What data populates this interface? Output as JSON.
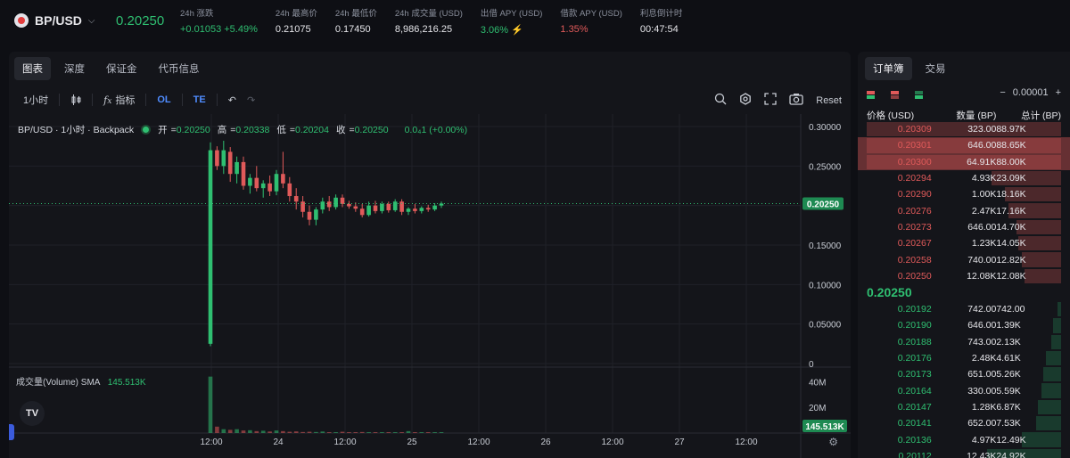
{
  "header": {
    "pair": "BP/USD",
    "last_price": "0.20250",
    "stats": [
      {
        "label": "24h 涨跌",
        "value": "+0.01053 +5.49%",
        "tone": "green"
      },
      {
        "label": "24h 最高价",
        "value": "0.21075",
        "tone": ""
      },
      {
        "label": "24h 最低价",
        "value": "0.17450",
        "tone": ""
      },
      {
        "label": "24h 成交量 (USD)",
        "value": "8,986,216.25",
        "tone": ""
      },
      {
        "label": "出借 APY (USD)",
        "value": "3.06% ⚡",
        "tone": "green"
      },
      {
        "label": "借款 APY (USD)",
        "value": "1.35%",
        "tone": "red"
      },
      {
        "label": "利息倒计时",
        "value": "00:47:54",
        "tone": ""
      }
    ]
  },
  "chart_tabs": [
    {
      "label": "图表",
      "active": true
    },
    {
      "label": "深度",
      "active": false
    },
    {
      "label": "保证金",
      "active": false
    },
    {
      "label": "代币信息",
      "active": false
    }
  ],
  "toolbar": {
    "interval": "1小时",
    "indicators": "指标",
    "ol": "OL",
    "te": "TE",
    "reset": "Reset"
  },
  "legend": {
    "title": "BP/USD · 1小时 · Backpack",
    "ohlc": [
      {
        "k": "开",
        "v": "0.20250"
      },
      {
        "k": "高",
        "v": "0.20338"
      },
      {
        "k": "低",
        "v": "0.20204"
      },
      {
        "k": "收",
        "v": "0.20250"
      }
    ],
    "change": "0.0₄1 (+0.00%)"
  },
  "volume_legend": {
    "label": "成交量(Volume) SMA",
    "value": "145.513K"
  },
  "tv_logo": "TV",
  "chart_data": {
    "type": "candlestick",
    "x_ticks": [
      "12:00",
      "24",
      "12:00",
      "25",
      "12:00",
      "26",
      "12:00",
      "27",
      "12:00"
    ],
    "price_axis": [
      "0.30000",
      "0.25000",
      "0.20000",
      "0.15000",
      "0.10000",
      "0.05000",
      "0"
    ],
    "ylim": [
      0,
      0.3
    ],
    "current_price": "0.20250",
    "volume_axis": [
      "40M",
      "20M"
    ],
    "volume_current": "145.513K",
    "colors": {
      "up": "#2fbf71",
      "down": "#e05a5a"
    },
    "candles": [
      {
        "o": 0.025,
        "h": 0.28,
        "l": 0.022,
        "c": 0.27
      },
      {
        "o": 0.27,
        "h": 0.275,
        "l": 0.245,
        "c": 0.25
      },
      {
        "o": 0.25,
        "h": 0.282,
        "l": 0.24,
        "c": 0.27
      },
      {
        "o": 0.268,
        "h": 0.274,
        "l": 0.23,
        "c": 0.24
      },
      {
        "o": 0.24,
        "h": 0.262,
        "l": 0.228,
        "c": 0.255
      },
      {
        "o": 0.255,
        "h": 0.262,
        "l": 0.22,
        "c": 0.225
      },
      {
        "o": 0.225,
        "h": 0.24,
        "l": 0.215,
        "c": 0.235
      },
      {
        "o": 0.235,
        "h": 0.25,
        "l": 0.218,
        "c": 0.222
      },
      {
        "o": 0.222,
        "h": 0.232,
        "l": 0.21,
        "c": 0.228
      },
      {
        "o": 0.228,
        "h": 0.238,
        "l": 0.212,
        "c": 0.218
      },
      {
        "o": 0.218,
        "h": 0.245,
        "l": 0.213,
        "c": 0.24
      },
      {
        "o": 0.24,
        "h": 0.268,
        "l": 0.222,
        "c": 0.228
      },
      {
        "o": 0.228,
        "h": 0.236,
        "l": 0.205,
        "c": 0.212
      },
      {
        "o": 0.212,
        "h": 0.222,
        "l": 0.195,
        "c": 0.205
      },
      {
        "o": 0.205,
        "h": 0.212,
        "l": 0.185,
        "c": 0.192
      },
      {
        "o": 0.192,
        "h": 0.2,
        "l": 0.175,
        "c": 0.182
      },
      {
        "o": 0.182,
        "h": 0.198,
        "l": 0.175,
        "c": 0.195
      },
      {
        "o": 0.195,
        "h": 0.21,
        "l": 0.19,
        "c": 0.205
      },
      {
        "o": 0.205,
        "h": 0.212,
        "l": 0.193,
        "c": 0.198
      },
      {
        "o": 0.198,
        "h": 0.214,
        "l": 0.195,
        "c": 0.21
      },
      {
        "o": 0.21,
        "h": 0.214,
        "l": 0.198,
        "c": 0.202
      },
      {
        "o": 0.202,
        "h": 0.206,
        "l": 0.196,
        "c": 0.199
      },
      {
        "o": 0.199,
        "h": 0.204,
        "l": 0.192,
        "c": 0.196
      },
      {
        "o": 0.196,
        "h": 0.202,
        "l": 0.185,
        "c": 0.188
      },
      {
        "o": 0.188,
        "h": 0.205,
        "l": 0.186,
        "c": 0.2
      },
      {
        "o": 0.2,
        "h": 0.206,
        "l": 0.19,
        "c": 0.193
      },
      {
        "o": 0.193,
        "h": 0.205,
        "l": 0.19,
        "c": 0.202
      },
      {
        "o": 0.202,
        "h": 0.205,
        "l": 0.191,
        "c": 0.194
      },
      {
        "o": 0.194,
        "h": 0.208,
        "l": 0.192,
        "c": 0.205
      },
      {
        "o": 0.205,
        "h": 0.208,
        "l": 0.188,
        "c": 0.192
      },
      {
        "o": 0.192,
        "h": 0.198,
        "l": 0.188,
        "c": 0.196
      },
      {
        "o": 0.196,
        "h": 0.202,
        "l": 0.19,
        "c": 0.193
      },
      {
        "o": 0.193,
        "h": 0.199,
        "l": 0.19,
        "c": 0.197
      },
      {
        "o": 0.197,
        "h": 0.201,
        "l": 0.192,
        "c": 0.195
      },
      {
        "o": 0.195,
        "h": 0.203,
        "l": 0.193,
        "c": 0.2
      },
      {
        "o": 0.2,
        "h": 0.205,
        "l": 0.197,
        "c": 0.2025
      }
    ],
    "volumes": [
      44,
      5,
      3,
      2.5,
      3,
      2,
      2.2,
      1.5,
      1.8,
      1.2,
      2,
      1.5,
      1,
      1.3,
      0.8,
      1,
      0.8,
      1.2,
      0.7,
      0.6,
      1,
      0.5,
      0.6,
      0.8,
      0.5,
      0.5,
      0.4,
      0.4,
      0.3,
      0.6,
      1.5,
      0.3,
      0.3,
      0.2,
      0.2,
      0.15
    ]
  },
  "orderbook": {
    "tabs": [
      {
        "label": "订单簿",
        "active": true
      },
      {
        "label": "交易",
        "active": false
      }
    ],
    "tick_size": "0.00001",
    "headers": [
      "价格 (USD)",
      "数量 (BP)",
      "总计 (BP)"
    ],
    "asks": [
      {
        "price": "0.20309",
        "qty": "323.00",
        "total": "88.97K",
        "depth": 1.0,
        "hl": false
      },
      {
        "price": "0.20301",
        "qty": "646.00",
        "total": "88.65K",
        "depth": 1.0,
        "hl": true
      },
      {
        "price": "0.20300",
        "qty": "64.91K",
        "total": "88.00K",
        "depth": 1.0,
        "hl": true
      },
      {
        "price": "0.20294",
        "qty": "4.93K",
        "total": "23.09K",
        "depth": 0.36
      },
      {
        "price": "0.20290",
        "qty": "1.00K",
        "total": "18.16K",
        "depth": 0.29
      },
      {
        "price": "0.20276",
        "qty": "2.47K",
        "total": "17.16K",
        "depth": 0.27
      },
      {
        "price": "0.20273",
        "qty": "646.00",
        "total": "14.70K",
        "depth": 0.23
      },
      {
        "price": "0.20267",
        "qty": "1.23K",
        "total": "14.05K",
        "depth": 0.22
      },
      {
        "price": "0.20258",
        "qty": "740.00",
        "total": "12.82K",
        "depth": 0.2
      },
      {
        "price": "0.20250",
        "qty": "12.08K",
        "total": "12.08K",
        "depth": 0.19
      }
    ],
    "mid_price": "0.20250",
    "bids": [
      {
        "price": "0.20192",
        "qty": "742.00",
        "total": "742.00",
        "depth": 0.02
      },
      {
        "price": "0.20190",
        "qty": "646.00",
        "total": "1.39K",
        "depth": 0.04
      },
      {
        "price": "0.20188",
        "qty": "743.00",
        "total": "2.13K",
        "depth": 0.05
      },
      {
        "price": "0.20176",
        "qty": "2.48K",
        "total": "4.61K",
        "depth": 0.08
      },
      {
        "price": "0.20173",
        "qty": "651.00",
        "total": "5.26K",
        "depth": 0.09
      },
      {
        "price": "0.20164",
        "qty": "330.00",
        "total": "5.59K",
        "depth": 0.1
      },
      {
        "price": "0.20147",
        "qty": "1.28K",
        "total": "6.87K",
        "depth": 0.12
      },
      {
        "price": "0.20141",
        "qty": "652.00",
        "total": "7.53K",
        "depth": 0.13
      },
      {
        "price": "0.20136",
        "qty": "4.97K",
        "total": "12.49K",
        "depth": 0.2
      },
      {
        "price": "0.20112",
        "qty": "12.43K",
        "total": "24.92K",
        "depth": 0.38
      }
    ]
  }
}
